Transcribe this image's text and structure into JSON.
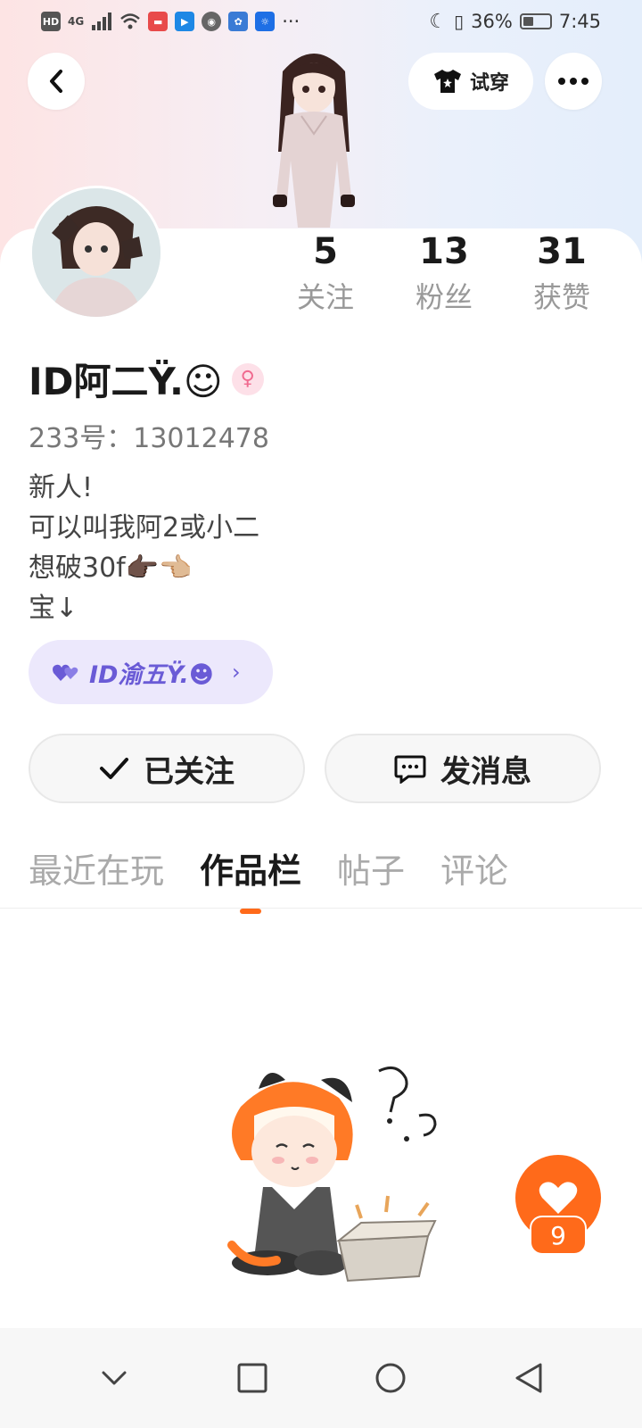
{
  "status_bar": {
    "left_badges": [
      "HD",
      "4G"
    ],
    "battery": "36%",
    "time": "7:45",
    "more": "···"
  },
  "header": {
    "try_on_label": "试穿"
  },
  "stats": [
    {
      "value": "5",
      "label": "关注"
    },
    {
      "value": "13",
      "label": "粉丝"
    },
    {
      "value": "31",
      "label": "获赞"
    }
  ],
  "profile": {
    "name": "ID阿二Ÿ.☺",
    "gender_icon": "female-icon",
    "uid_text": "233号：13012478",
    "bio_lines": [
      "新人!",
      "可以叫我阿2或小二",
      "想破30f👉🏿👈🏼",
      "宝↓"
    ]
  },
  "cp": {
    "label": "ID渝五Ÿ.☻"
  },
  "actions": {
    "follow_label": "已关注",
    "message_label": "发消息"
  },
  "tabs": [
    {
      "label": "最近在玩",
      "active": false
    },
    {
      "label": "作品栏",
      "active": true
    },
    {
      "label": "帖子",
      "active": false
    },
    {
      "label": "评论",
      "active": false
    }
  ],
  "like": {
    "count": "9"
  },
  "colors": {
    "accent": "#ff6a1a",
    "cp_text": "#6a5bd6",
    "cp_bg": "#ece8fc"
  }
}
